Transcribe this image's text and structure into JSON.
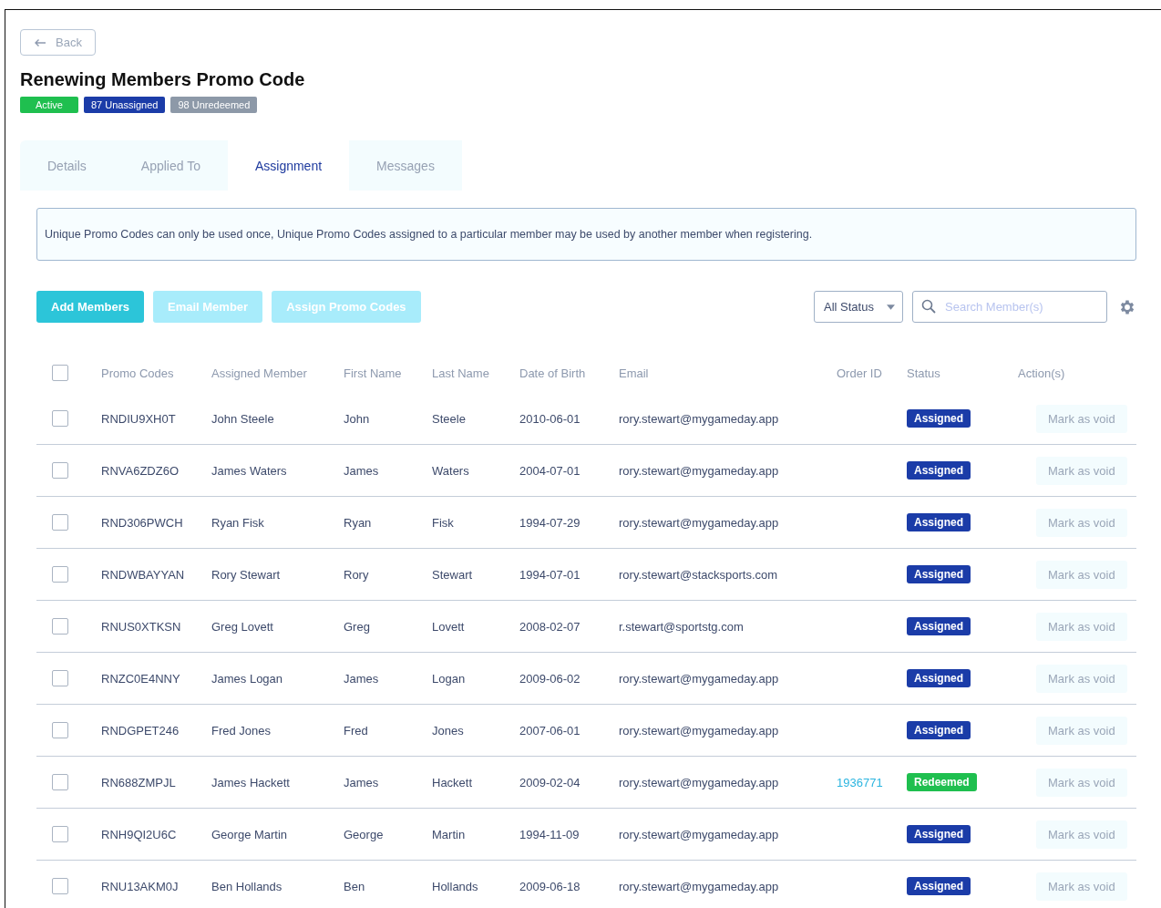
{
  "back_button": {
    "label": "Back"
  },
  "title": "Renewing Members Promo Code",
  "badges": [
    {
      "label": "Active",
      "color": "#1fbf4f"
    },
    {
      "label": "87 Unassigned",
      "color": "#1b3ca8"
    },
    {
      "label": "98 Unredeemed",
      "color": "#8d99a8"
    }
  ],
  "tabs": [
    {
      "label": "Details",
      "selected": false
    },
    {
      "label": "Applied To",
      "selected": false
    },
    {
      "label": "Assignment",
      "selected": true
    },
    {
      "label": "Messages",
      "selected": false
    }
  ],
  "notice": "Unique Promo Codes can only be used once, Unique Promo Codes assigned to a particular member may be used by another member when registering.",
  "actions": [
    {
      "label": "Add Members",
      "disabled": false
    },
    {
      "label": "Email Member",
      "disabled": true
    },
    {
      "label": "Assign Promo Codes",
      "disabled": true
    }
  ],
  "status_filter": {
    "value": "All Status"
  },
  "search": {
    "placeholder": "Search Member(s)"
  },
  "table": {
    "select_all": {
      "checked": false
    },
    "columns": [
      "Promo Codes",
      "Assigned Member",
      "First Name",
      "Last Name",
      "Date of Birth",
      "Email",
      "Order ID",
      "Status",
      "Action(s)"
    ],
    "rows": [
      {
        "checked": false,
        "code": "RNDIU9XH0T",
        "member": "John Steele",
        "first": "John",
        "last": "Steele",
        "dob": "2010-06-01",
        "email": "rory.stewart@mygameday.app",
        "status": "Assigned",
        "kind": "assigned",
        "action": "Mark as void"
      },
      {
        "checked": false,
        "code": "RNVA6ZDZ6O",
        "member": "James Waters",
        "first": "James",
        "last": "Waters",
        "dob": "2004-07-01",
        "email": "rory.stewart@mygameday.app",
        "status": "Assigned",
        "kind": "assigned",
        "action": "Mark as void"
      },
      {
        "checked": false,
        "code": "RND306PWCH",
        "member": "Ryan Fisk",
        "first": "Ryan",
        "last": "Fisk",
        "dob": "1994-07-29",
        "email": "rory.stewart@mygameday.app",
        "status": "Assigned",
        "kind": "assigned",
        "action": "Mark as void"
      },
      {
        "checked": false,
        "code": "RNDWBAYYAN",
        "member": "Rory Stewart",
        "first": "Rory",
        "last": "Stewart",
        "dob": "1994-07-01",
        "email": "rory.stewart@stacksports.com",
        "status": "Assigned",
        "kind": "assigned",
        "action": "Mark as void"
      },
      {
        "checked": false,
        "code": "RNUS0XTKSN",
        "member": "Greg Lovett",
        "first": "Greg",
        "last": "Lovett",
        "dob": "2008-02-07",
        "email": "r.stewart@sportstg.com",
        "status": "Assigned",
        "kind": "assigned",
        "action": "Mark as void"
      },
      {
        "checked": false,
        "code": "RNZC0E4NNY",
        "member": "James Logan",
        "first": "James",
        "last": "Logan",
        "dob": "2009-06-02",
        "email": "rory.stewart@mygameday.app",
        "status": "Assigned",
        "kind": "assigned",
        "action": "Mark as void"
      },
      {
        "checked": false,
        "code": "RNDGPET246",
        "member": "Fred Jones",
        "first": "Fred",
        "last": "Jones",
        "dob": "2007-06-01",
        "email": "rory.stewart@mygameday.app",
        "status": "Assigned",
        "kind": "assigned",
        "action": "Mark as void"
      },
      {
        "checked": false,
        "code": "RN688ZMPJL",
        "member": "James Hackett",
        "first": "James",
        "last": "Hackett",
        "dob": "2009-02-04",
        "email": "rory.stewart@mygameday.app",
        "order_id": "1936771",
        "status": "Redeemed",
        "kind": "redeemed",
        "action": "Mark as void"
      },
      {
        "checked": false,
        "code": "RNH9QI2U6C",
        "member": "George Martin",
        "first": "George",
        "last": "Martin",
        "dob": "1994-11-09",
        "email": "rory.stewart@mygameday.app",
        "status": "Assigned",
        "kind": "assigned",
        "action": "Mark as void"
      },
      {
        "checked": false,
        "code": "RNU13AKM0J",
        "member": "Ben Hollands",
        "first": "Ben",
        "last": "Hollands",
        "dob": "2009-06-18",
        "email": "rory.stewart@mygameday.app",
        "status": "Assigned",
        "kind": "assigned",
        "action": "Mark as void"
      }
    ]
  }
}
